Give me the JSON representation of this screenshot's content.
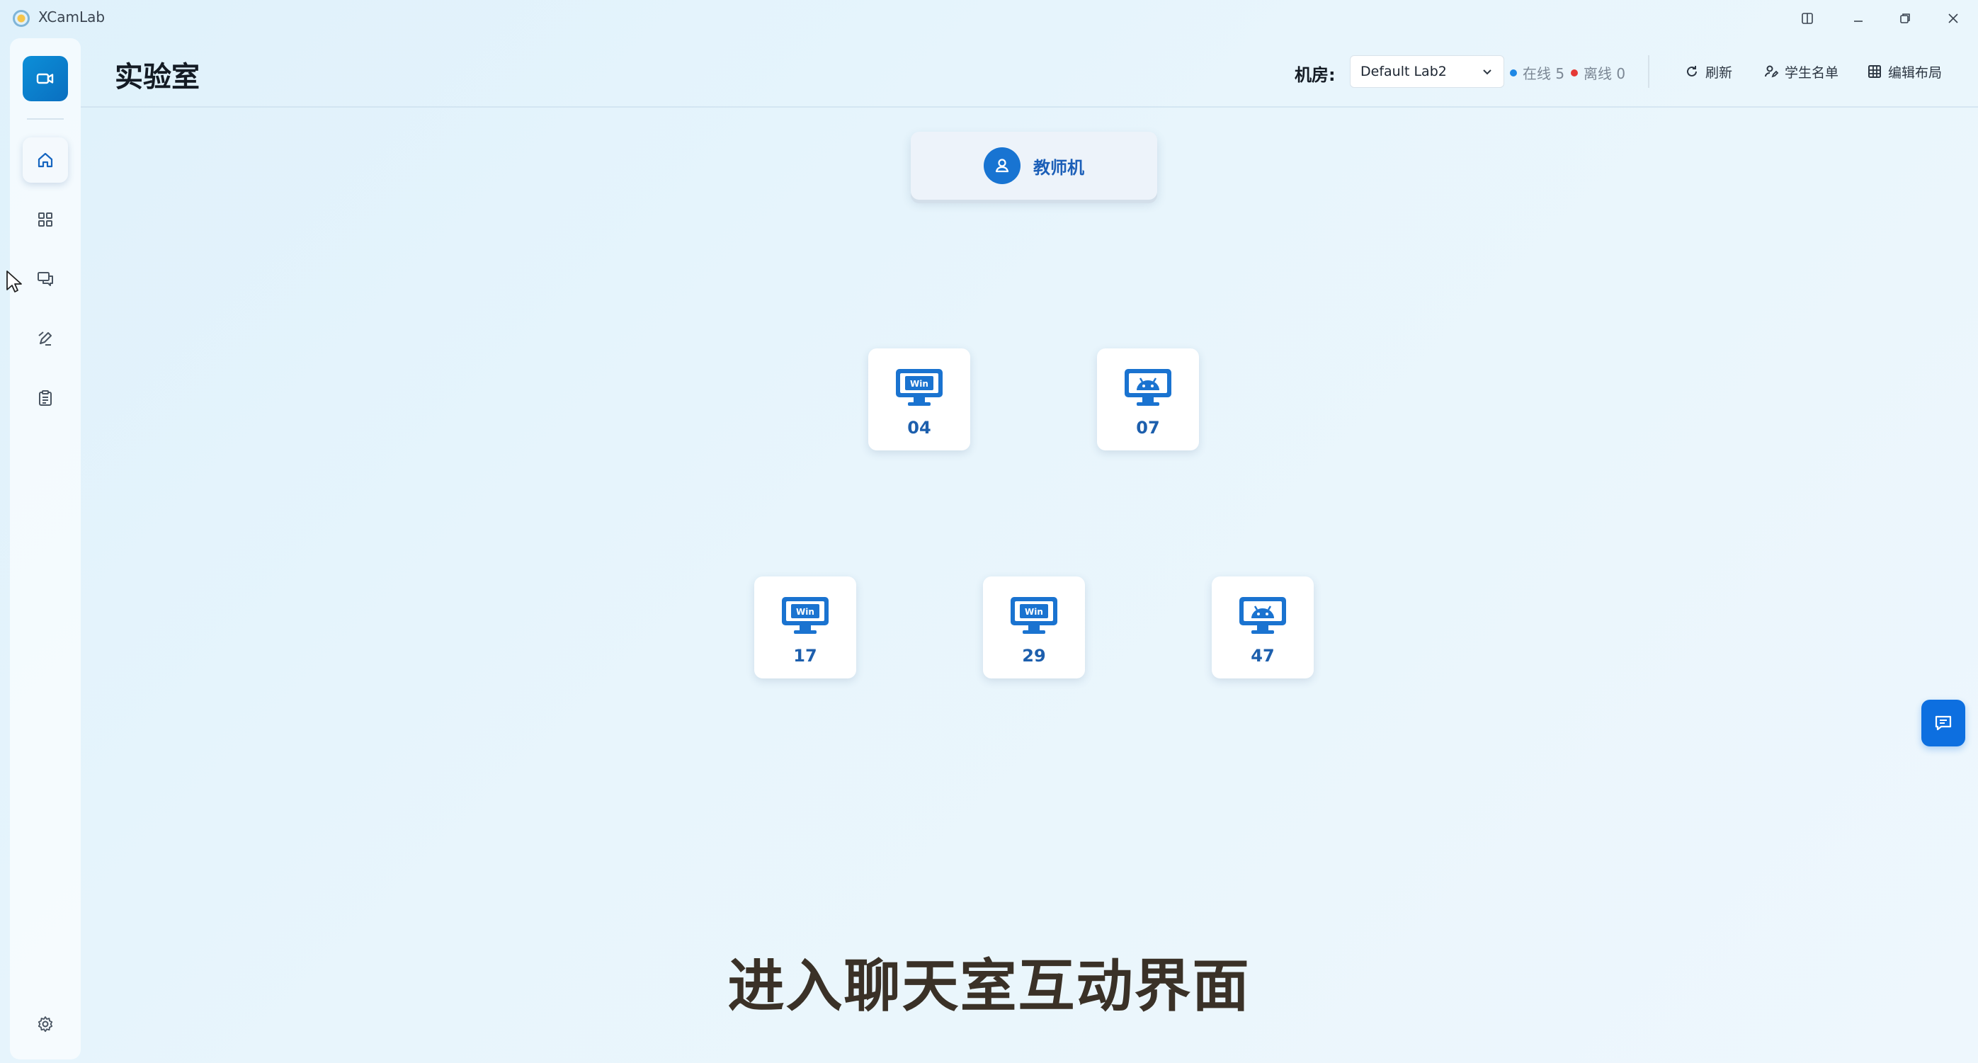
{
  "window": {
    "app_title": "XCamLab",
    "controls": [
      "sidebar-toggle",
      "minimize",
      "restore",
      "close"
    ]
  },
  "sidebar": {
    "brand_icon": "video-camera-icon",
    "items": [
      {
        "icon": "home-icon",
        "active": true
      },
      {
        "icon": "grid-icon",
        "active": false
      },
      {
        "icon": "chat-icon",
        "active": false
      },
      {
        "icon": "pen-icon",
        "active": false
      },
      {
        "icon": "clipboard-icon",
        "active": false
      }
    ],
    "bottom_icon": "settings-icon"
  },
  "header": {
    "title": "实验室",
    "room_label": "机房:",
    "room_selected": "Default Lab2",
    "online_text": "在线 5",
    "offline_text": "离线 0",
    "refresh_label": "刷新",
    "students_label": "学生名单",
    "edit_layout_label": "编辑布局"
  },
  "teacher": {
    "label": "教师机"
  },
  "stations": [
    {
      "number": "04",
      "os": "Win"
    },
    {
      "number": "07",
      "os": "Android"
    },
    {
      "number": "17",
      "os": "Win"
    },
    {
      "number": "29",
      "os": "Win"
    },
    {
      "number": "47",
      "os": "Android"
    }
  ],
  "os_badge_text": "Win",
  "caption": "进入聊天室互动界面",
  "colors": {
    "accent": "#0d6fe0",
    "online": "#1e88e5",
    "offline": "#e53935",
    "station_blue": "#1a73d0"
  }
}
